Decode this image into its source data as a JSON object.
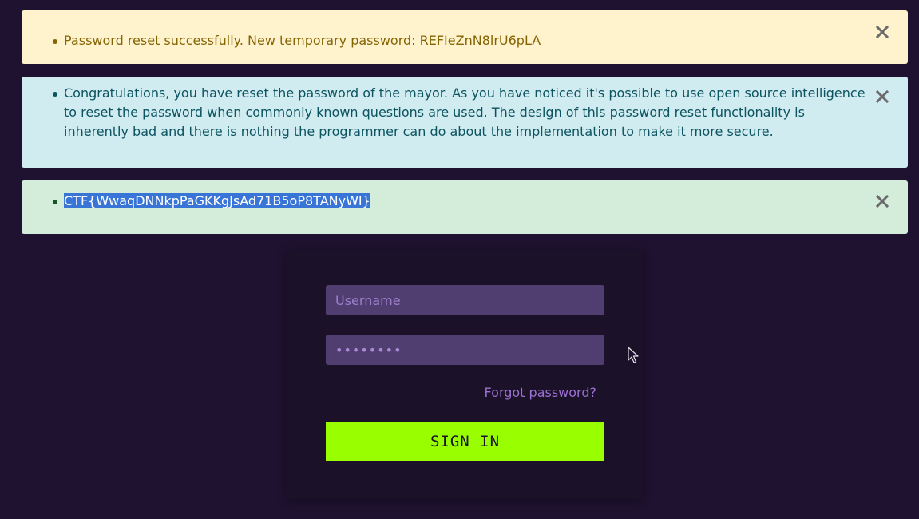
{
  "alerts": {
    "warning": {
      "message": "Password reset successfully. New temporary password: REFIeZnN8lrU6pLA",
      "color": "#856404",
      "background": "#fff3cd"
    },
    "info": {
      "message": "Congratulations, you have reset the password of the mayor. As you have noticed it's possible to use open source intelligence to reset the password when commonly known questions are used. The design of this password reset functionality is inherently bad and there is nothing the programmer can do about the implementation to make it more secure.",
      "color": "#0c5460",
      "background": "#d1ecf1"
    },
    "success": {
      "message": "CTF{WwaqDNNkpPaGKKgJsAd71B5oP8TANyWI}",
      "color": "#155724",
      "background": "#d4edda"
    },
    "close_icon": "close-icon"
  },
  "login": {
    "username_placeholder": "Username",
    "password_value": "••••••••",
    "forgot_password_label": "Forgot password?",
    "sign_in_label": "SIGN IN",
    "sign_in_color": "#99ff00",
    "field_background": "#513e71"
  },
  "page": {
    "background": "#1e1230"
  }
}
